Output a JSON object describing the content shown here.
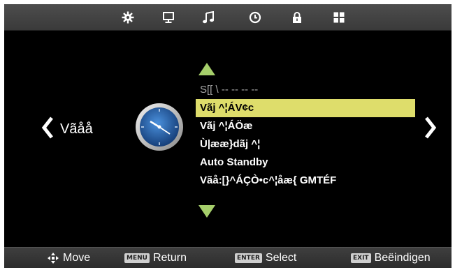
{
  "top_tabs": [
    {
      "icon": "settings-gear-icon"
    },
    {
      "icon": "monitor-icon"
    },
    {
      "icon": "music-note-icon"
    },
    {
      "icon": "clock-icon"
    },
    {
      "icon": "lock-icon"
    },
    {
      "icon": "grid-icon"
    }
  ],
  "category": {
    "label": "Vãåå",
    "icon": "analog-clock-icon"
  },
  "menu": {
    "items": [
      {
        "label": "S[[ \\ --  --      --  --",
        "state": "disabled"
      },
      {
        "label": "Vãj ^¦ÁV¢c",
        "state": "selected"
      },
      {
        "label": "Vãj ^¦ÁÖæ",
        "state": "normal"
      },
      {
        "label": "Ù|ææ}dãj ^¦",
        "state": "normal"
      },
      {
        "label": "Auto Standby",
        "state": "normal"
      },
      {
        "label": "Vãå:[}^ÁÇÒ•c^¦åæ{  GMTÉF",
        "state": "normal"
      }
    ]
  },
  "help": {
    "move_label": "Move",
    "return_key": "MENU",
    "return_label": "Return",
    "select_key": "ENTER",
    "select_label": "Select",
    "exit_key": "EXIT",
    "exit_label": "Beëindigen"
  },
  "colors": {
    "selected_bg": "#dedd6b",
    "nav_arrow": "#a6cf6b",
    "clock_face": "#2a6fc4"
  }
}
